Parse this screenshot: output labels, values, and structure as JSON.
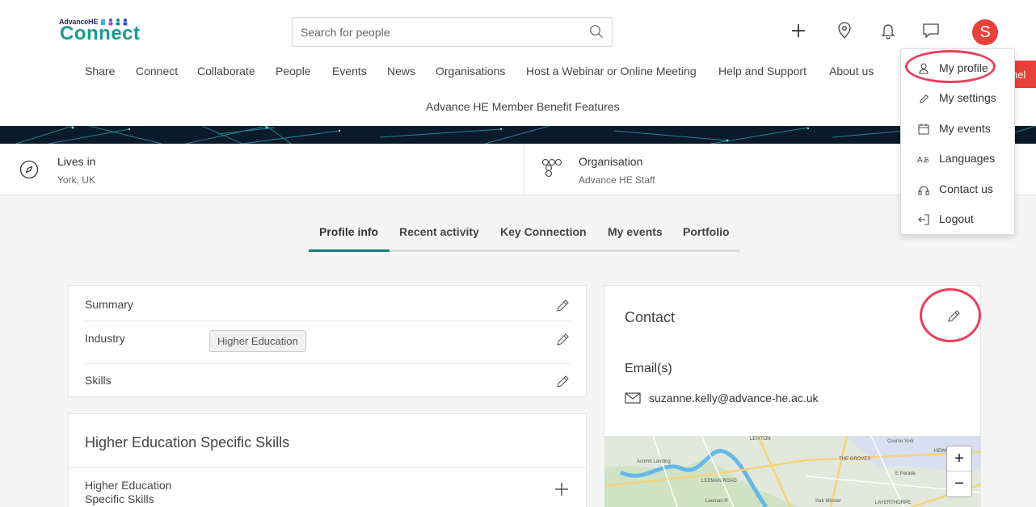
{
  "header": {
    "logo_small": "AdvanceHE",
    "logo_big": "Connect",
    "search_placeholder": "Search for people",
    "avatar_initial": "S"
  },
  "nav": {
    "items": [
      "Share",
      "Connect",
      "Collaborate",
      "People",
      "Events",
      "News",
      "Organisations",
      "Host a Webinar or Online Meeting",
      "Help and Support",
      "About us"
    ],
    "second_row": "Advance HE Member Benefit Features",
    "cut_tab": "nel"
  },
  "info": {
    "lives_label": "Lives in",
    "lives_value": "York, UK",
    "org_label": "Organisation",
    "org_value": "Advance HE Staff"
  },
  "tabs": [
    "Profile info",
    "Recent activity",
    "Key Connection",
    "My events",
    "Portfolio"
  ],
  "profile": {
    "summary_label": "Summary",
    "industry_label": "Industry",
    "industry_value": "Higher Education",
    "skills_label": "Skills"
  },
  "he_skills": {
    "title": "Higher Education Specific Skills",
    "row_label_1": "Higher Education",
    "row_label_2": "Specific Skills"
  },
  "contact": {
    "title": "Contact",
    "emails_label": "Email(s)",
    "email": "suzanne.kelly@advance-he.ac.uk"
  },
  "map": {
    "zoom_in": "+",
    "zoom_out": "−",
    "labels": [
      "Acomb Landing",
      "LEEMAN ROAD",
      "THE GROVES",
      "LAYERTHORPE",
      "HEWOR",
      "Course York",
      "E Parade",
      "York Minster",
      "Leeman R",
      "LEIYTON"
    ]
  },
  "dropdown": {
    "items": [
      {
        "label": "My profile",
        "icon": "user-icon"
      },
      {
        "label": "My settings",
        "icon": "pencil-icon"
      },
      {
        "label": "My events",
        "icon": "calendar-icon"
      },
      {
        "label": "Languages",
        "icon": "translate-icon"
      },
      {
        "label": "Contact us",
        "icon": "headphones-icon"
      },
      {
        "label": "Logout",
        "icon": "logout-icon"
      }
    ]
  },
  "colors": {
    "accent": "#1a7a72",
    "brand_teal": "#1a9a8c",
    "avatar": "#e8403a",
    "highlight_ring": "#e8405a"
  }
}
